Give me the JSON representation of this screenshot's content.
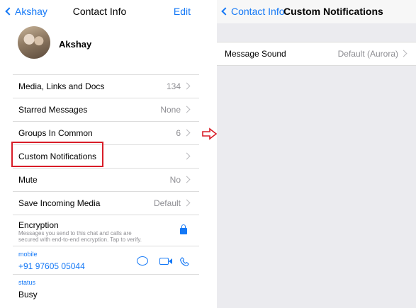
{
  "left": {
    "nav": {
      "back_label": "Akshay",
      "title": "Contact Info",
      "edit_label": "Edit"
    },
    "profile": {
      "name": "Akshay"
    },
    "rows": [
      {
        "label": "Media, Links and Docs",
        "value": "134"
      },
      {
        "label": "Starred Messages",
        "value": "None"
      },
      {
        "label": "Groups In Common",
        "value": "6"
      },
      {
        "label": "Custom Notifications",
        "value": ""
      },
      {
        "label": "Mute",
        "value": "No"
      },
      {
        "label": "Save Incoming Media",
        "value": "Default"
      }
    ],
    "encryption": {
      "label": "Encryption",
      "line1": "Messages you send to this chat and calls are",
      "line2": "secured with end-to-end encryption. Tap to verify."
    },
    "phone": {
      "caption": "mobile",
      "number": "+91 97605 05044"
    },
    "status": {
      "caption": "status",
      "text": "Busy"
    }
  },
  "right": {
    "nav": {
      "back_label": "Contact Info",
      "title": "Custom Notifications"
    },
    "message_sound": {
      "label": "Message Sound",
      "value": "Default (Aurora)"
    }
  },
  "colors": {
    "accent": "#1478f6",
    "highlight": "#d81d28",
    "arrow": "#d81d28"
  },
  "icons": [
    "chevron-left-icon",
    "chevron-right-icon",
    "lock-icon",
    "message-icon",
    "video-icon",
    "phone-icon",
    "right-arrow-icon"
  ]
}
